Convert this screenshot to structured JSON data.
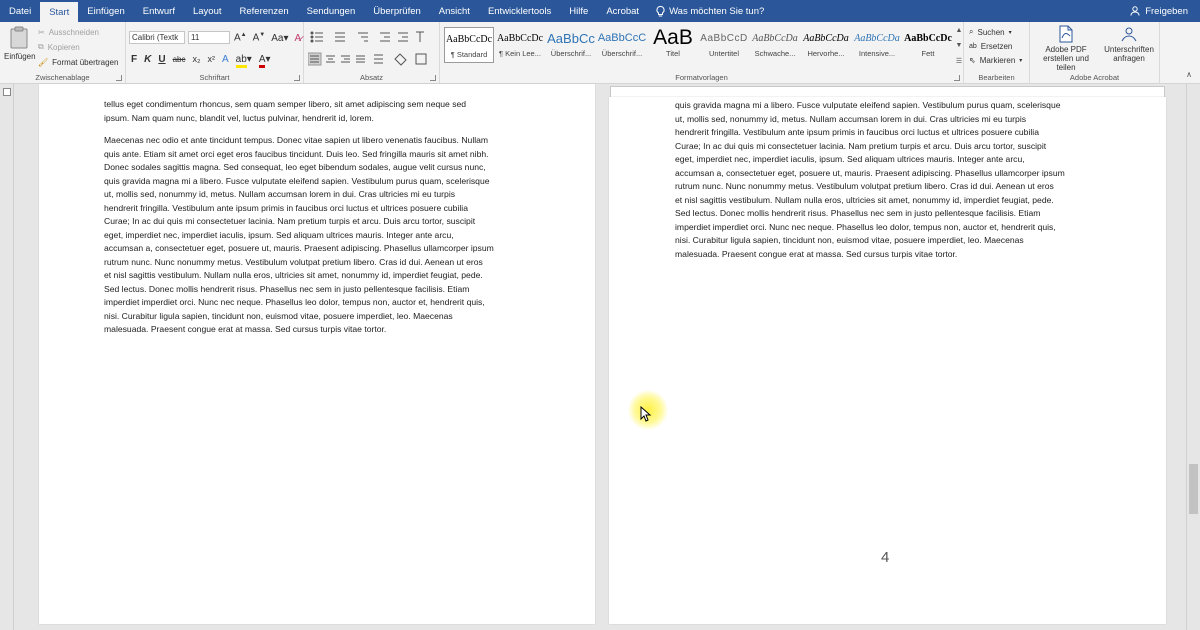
{
  "menu": {
    "tabs": [
      "Datei",
      "Start",
      "Einfügen",
      "Entwurf",
      "Layout",
      "Referenzen",
      "Sendungen",
      "Überprüfen",
      "Ansicht",
      "Entwicklertools",
      "Hilfe",
      "Acrobat"
    ],
    "active_tab": "Start",
    "tell_me": "Was möchten Sie tun?",
    "share": "Freigeben"
  },
  "clipboard": {
    "paste": "Einfügen",
    "cut": "Ausschneiden",
    "copy": "Kopieren",
    "format_painter": "Format übertragen",
    "label": "Zwischenablage"
  },
  "font": {
    "name": "Calibri (Textk",
    "size": "11",
    "bold": "F",
    "italic": "K",
    "underline": "U",
    "label": "Schriftart"
  },
  "paragraph": {
    "label": "Absatz"
  },
  "styles": {
    "items": [
      {
        "preview": "AaBbCcDc",
        "name": "¶ Standard"
      },
      {
        "preview": "AaBbCcDc",
        "name": "¶ Kein Lee..."
      },
      {
        "preview": "AaBbCc",
        "name": "Überschrif..."
      },
      {
        "preview": "AaBbCcC",
        "name": "Überschrif..."
      },
      {
        "preview": "AaB",
        "name": "Titel"
      },
      {
        "preview": "AaBbCcD",
        "name": "Untertitel"
      },
      {
        "preview": "AaBbCcDa",
        "name": "Schwache..."
      },
      {
        "preview": "AaBbCcDa",
        "name": "Hervorhe..."
      },
      {
        "preview": "AaBbCcDa",
        "name": "Intensive..."
      },
      {
        "preview": "AaBbCcDc",
        "name": "Fett"
      }
    ],
    "label": "Formatvorlagen"
  },
  "editing": {
    "find": "Suchen",
    "replace": "Ersetzen",
    "select": "Markieren",
    "label": "Bearbeiten"
  },
  "acrobat": {
    "create_pdf_line1": "Adobe PDF",
    "create_pdf_line2": "erstellen und teilen",
    "sign_line1": "Unterschriften",
    "sign_line2": "anfragen",
    "label": "Adobe Acrobat"
  },
  "page_left": {
    "lines_p1": [
      "tellus eget condimentum rhoncus, sem quam semper libero, sit amet adipiscing sem neque sed",
      "ipsum. Nam quam nunc, blandit vel, luctus pulvinar, hendrerit id, lorem."
    ],
    "lines_p2": [
      "Maecenas nec odio et ante tincidunt tempus. Donec vitae sapien ut libero venenatis faucibus. Nullam",
      "quis ante. Etiam sit amet orci eget eros faucibus tincidunt. Duis leo. Sed fringilla mauris sit amet nibh.",
      "Donec sodales sagittis magna. Sed consequat, leo eget bibendum sodales, augue velit cursus nunc,",
      "quis gravida magna mi a libero. Fusce vulputate eleifend sapien. Vestibulum purus quam, scelerisque",
      "ut, mollis sed, nonummy id, metus. Nullam accumsan lorem in dui. Cras ultricies mi eu turpis",
      "hendrerit fringilla. Vestibulum ante ipsum primis in faucibus orci luctus et ultrices posuere cubilia",
      "Curae; In ac dui quis mi consectetuer lacinia. Nam pretium turpis et arcu. Duis arcu tortor, suscipit",
      "eget, imperdiet nec, imperdiet iaculis, ipsum. Sed aliquam ultrices mauris. Integer ante arcu,",
      "accumsan a, consectetuer eget, posuere ut, mauris. Praesent adipiscing. Phasellus ullamcorper ipsum",
      "rutrum nunc. Nunc nonummy metus. Vestibulum volutpat pretium libero. Cras id dui. Aenean ut eros",
      "et nisl sagittis vestibulum. Nullam nulla eros, ultricies sit amet, nonummy id, imperdiet feugiat, pede.",
      "Sed lectus. Donec mollis hendrerit risus. Phasellus nec sem in justo pellentesque facilisis. Etiam",
      "imperdiet imperdiet orci. Nunc nec neque. Phasellus leo dolor, tempus non, auctor et, hendrerit quis,",
      "nisi. Curabitur ligula sapien, tincidunt non, euismod vitae, posuere imperdiet, leo. Maecenas",
      "malesuada. Praesent congue erat at massa. Sed cursus turpis vitae tortor."
    ]
  },
  "page_right": {
    "lines": [
      "quis gravida magna mi a libero. Fusce vulputate eleifend sapien. Vestibulum purus quam, scelerisque",
      "ut, mollis sed, nonummy id, metus. Nullam accumsan lorem in dui. Cras ultricies mi eu turpis",
      "hendrerit fringilla. Vestibulum ante ipsum primis in faucibus orci luctus et ultrices posuere cubilia",
      "Curae; In ac dui quis mi consectetuer lacinia. Nam pretium turpis et arcu. Duis arcu tortor, suscipit",
      "eget, imperdiet nec, imperdiet iaculis, ipsum. Sed aliquam ultrices mauris. Integer ante arcu,",
      "accumsan a, consectetuer eget, posuere ut, mauris. Praesent adipiscing. Phasellus ullamcorper ipsum",
      "rutrum nunc. Nunc nonummy metus. Vestibulum volutpat pretium libero. Cras id dui. Aenean ut eros",
      "et nisl sagittis vestibulum. Nullam nulla eros, ultricies sit amet, nonummy id, imperdiet feugiat, pede.",
      "Sed lectus. Donec mollis hendrerit risus. Phasellus nec sem in justo pellentesque facilisis. Etiam",
      "imperdiet imperdiet orci. Nunc nec neque. Phasellus leo dolor, tempus non, auctor et, hendrerit quis,",
      "nisi. Curabitur ligula sapien, tincidunt non, euismod vitae, posuere imperdiet, leo. Maecenas",
      "malesuada. Praesent congue erat at massa. Sed cursus turpis vitae tortor."
    ],
    "page_number": "4"
  },
  "colors": {
    "word_blue": "#2b579a",
    "highlight_yellow": "#ffe600",
    "font_red": "#d00000"
  }
}
